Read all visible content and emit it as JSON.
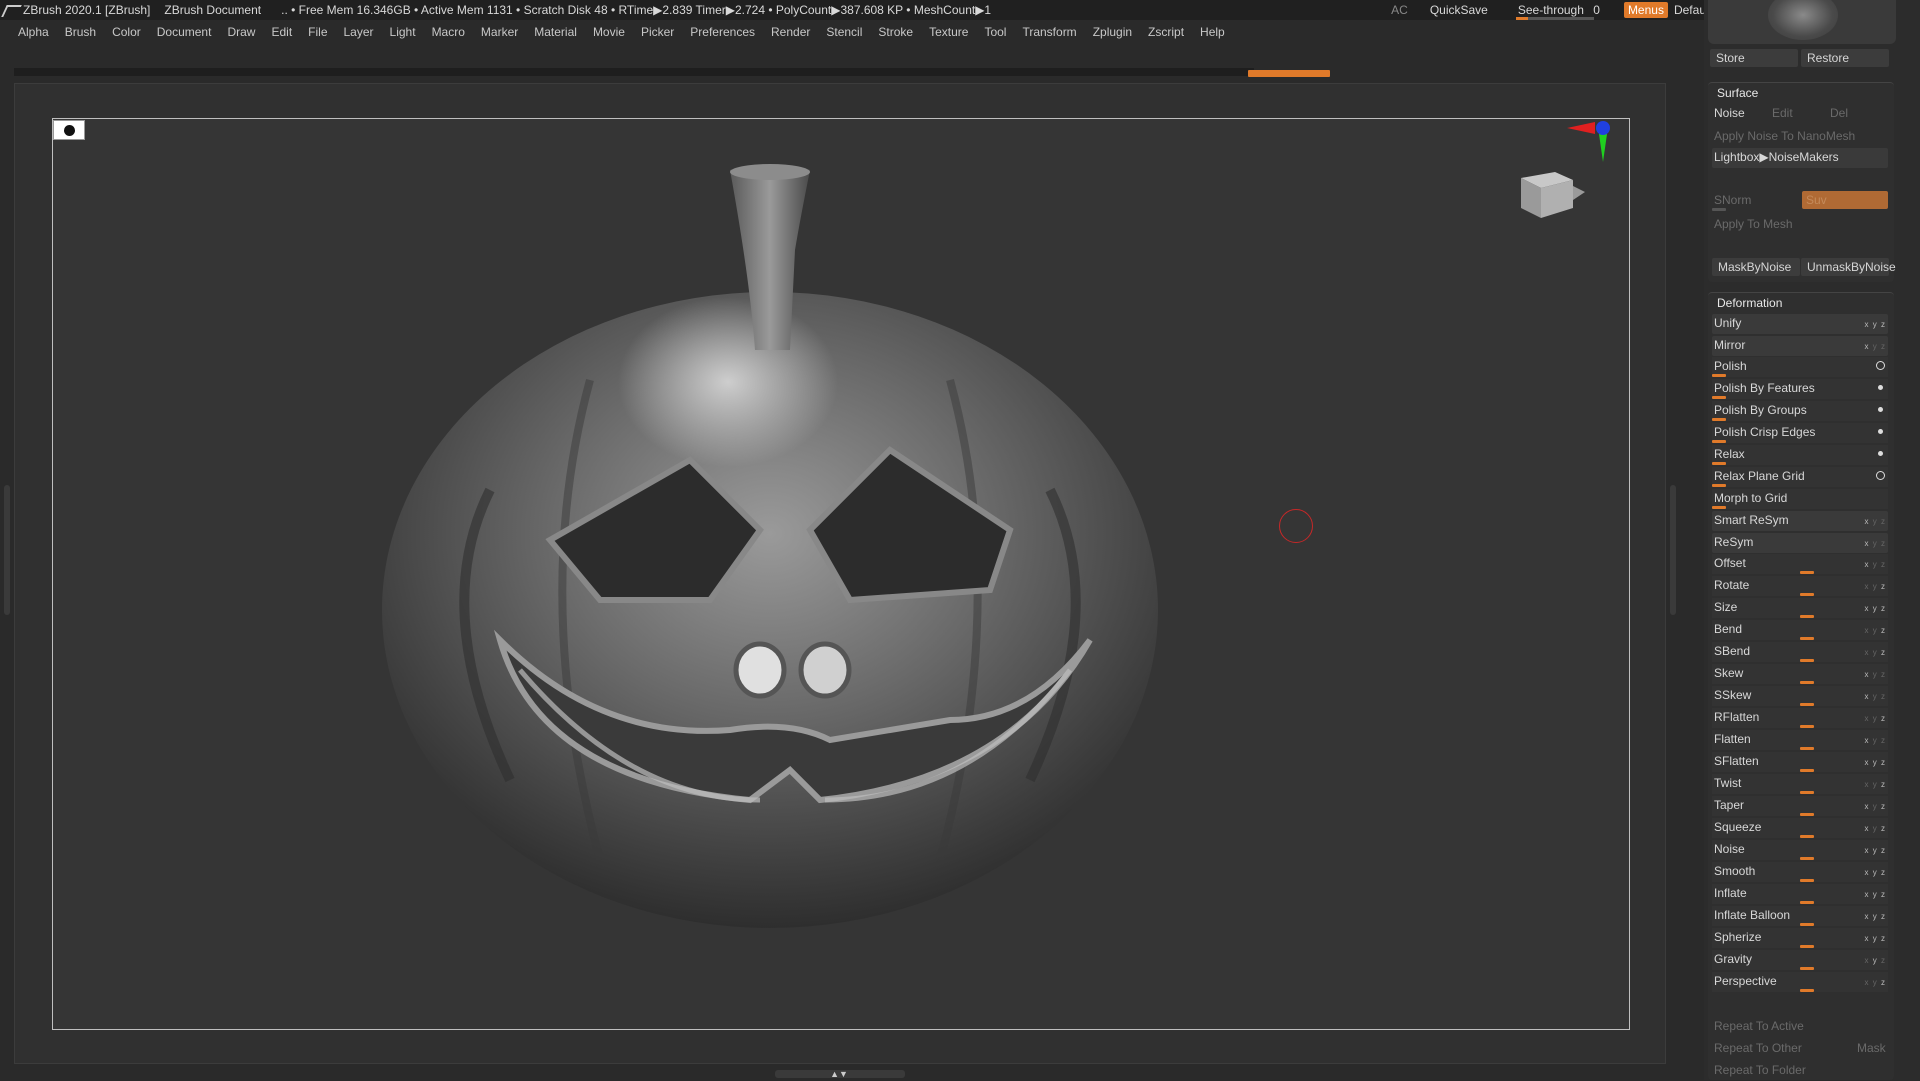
{
  "titlebar": {
    "app": "ZBrush 2020.1 [ZBrush]",
    "document": "ZBrush Document",
    "stats": ".. • Free Mem 16.346GB • Active Mem 1131 • Scratch Disk 48 •  RTime▶2.839 Timer▶2.724 • PolyCount▶387.608 KP  • MeshCount▶1",
    "ac": "AC",
    "quicksave": "QuickSave",
    "see_through_label": "See-through",
    "see_through_value": "0",
    "menus": "Menus",
    "default_zscript": "DefaultZScript"
  },
  "menubar": [
    "Alpha",
    "Brush",
    "Color",
    "Document",
    "Draw",
    "Edit",
    "File",
    "Layer",
    "Light",
    "Macro",
    "Marker",
    "Material",
    "Movie",
    "Picker",
    "Preferences",
    "Render",
    "Stencil",
    "Stroke",
    "Texture",
    "Tool",
    "Transform",
    "Zplugin",
    "Zscript",
    "Help"
  ],
  "panel": {
    "store": "Store",
    "restore": "Restore",
    "surface": {
      "title": "Surface",
      "noise": "Noise",
      "edit": "Edit",
      "del": "Del",
      "apply_noise_nano": "Apply Noise To NanoMesh",
      "lightbox": "Lightbox▶NoiseMakers",
      "snorm": "SNorm",
      "suv": "Suv",
      "apply_to_mesh": "Apply To Mesh",
      "mask_by_noise": "MaskByNoise",
      "unmask_by_noise": "UnmaskByNoise"
    },
    "deformation": {
      "title": "Deformation",
      "items": [
        "Unify",
        "Mirror",
        "Polish",
        "Polish By Features",
        "Polish By Groups",
        "Polish Crisp Edges",
        "Relax",
        "Relax Plane Grid",
        "Morph to Grid",
        "Smart ReSym",
        "ReSym",
        "Offset",
        "Rotate",
        "Size",
        "Bend",
        "SBend",
        "Skew",
        "SSkew",
        "RFlatten",
        "Flatten",
        "SFlatten",
        "Twist",
        "Taper",
        "Squeeze",
        "Noise",
        "Smooth",
        "Inflate",
        "Inflate Balloon",
        "Spherize",
        "Gravity",
        "Perspective"
      ],
      "repeat_active": "Repeat To Active",
      "repeat_other": "Repeat To Other",
      "mask": "Mask",
      "repeat_folder": "Repeat To Folder"
    }
  },
  "colors": {
    "accent": "#e07a2a",
    "background": "#2a2a2a",
    "panel": "#2c2c2c"
  }
}
